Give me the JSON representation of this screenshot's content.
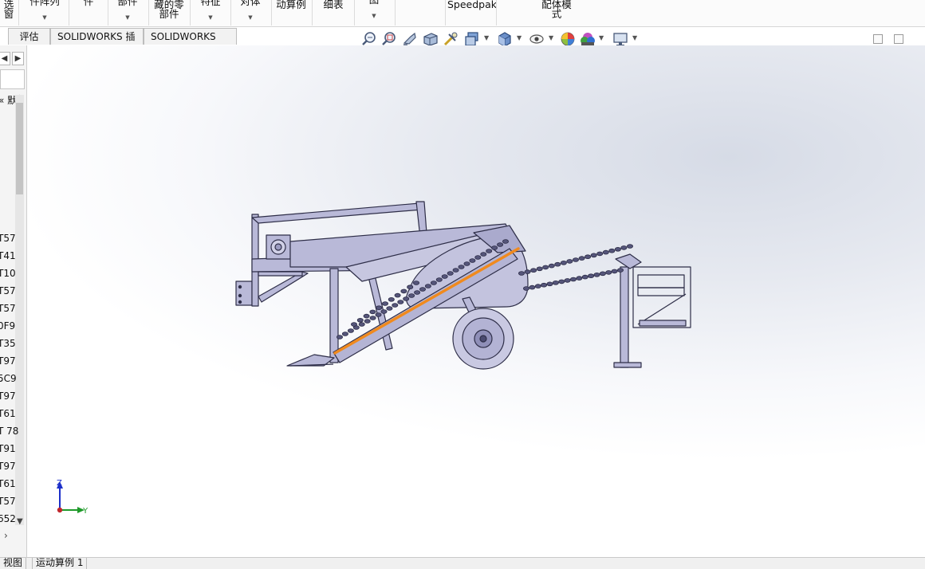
{
  "ribbon": {
    "items": [
      {
        "label": "选窗",
        "dropdown": false
      },
      {
        "label": "件阵列",
        "dropdown": true
      },
      {
        "label": "件",
        "dropdown": false
      },
      {
        "label": "部件",
        "dropdown": true
      },
      {
        "label": "藏的零",
        "label2": "部件",
        "dropdown": false
      },
      {
        "label": "特征",
        "dropdown": true
      },
      {
        "label": "对体",
        "dropdown": true
      },
      {
        "label": "动算例",
        "dropdown": false
      },
      {
        "label": "细表",
        "dropdown": false
      },
      {
        "label": "图",
        "dropdown": true
      },
      {
        "label": "Speedpak",
        "dropdown": false
      },
      {
        "label": "配体模",
        "label2": "式",
        "dropdown": false
      }
    ]
  },
  "tabs": [
    "评估",
    "SOLIDWORKS 插件",
    "SOLIDWORKS MBD"
  ],
  "heads_up_toolbar": [
    "zoom-to-fit-icon",
    "zoom-to-area-icon",
    "previous-view-icon",
    "section-view-icon",
    "dynamic-annotation-icon",
    "view-orientation-icon",
    "display-style-icon",
    "hide-show-items-icon",
    "edit-appearance-icon",
    "apply-scene-icon",
    "view-settings-icon"
  ],
  "feature_tree": {
    "header_fragment": "« 默",
    "items": [
      "T57",
      "T41",
      "T10",
      "T57",
      "T57",
      "0F9",
      "T35",
      "T97",
      "5C9",
      "T97",
      "T61",
      "T 78",
      "T91",
      "T97",
      "T61",
      "T57",
      "652"
    ]
  },
  "triad": {
    "z": "Z",
    "y": "Y"
  },
  "bottom_tabs": [
    "视图",
    "运动算例 1"
  ],
  "colors": {
    "model_fill": "#b9b9d8",
    "model_stroke": "#3a3a55",
    "highlight": "#f08a1e",
    "triad_z": "#1c2fc9",
    "triad_y": "#1f9a2a",
    "triad_origin": "#c1272d"
  }
}
